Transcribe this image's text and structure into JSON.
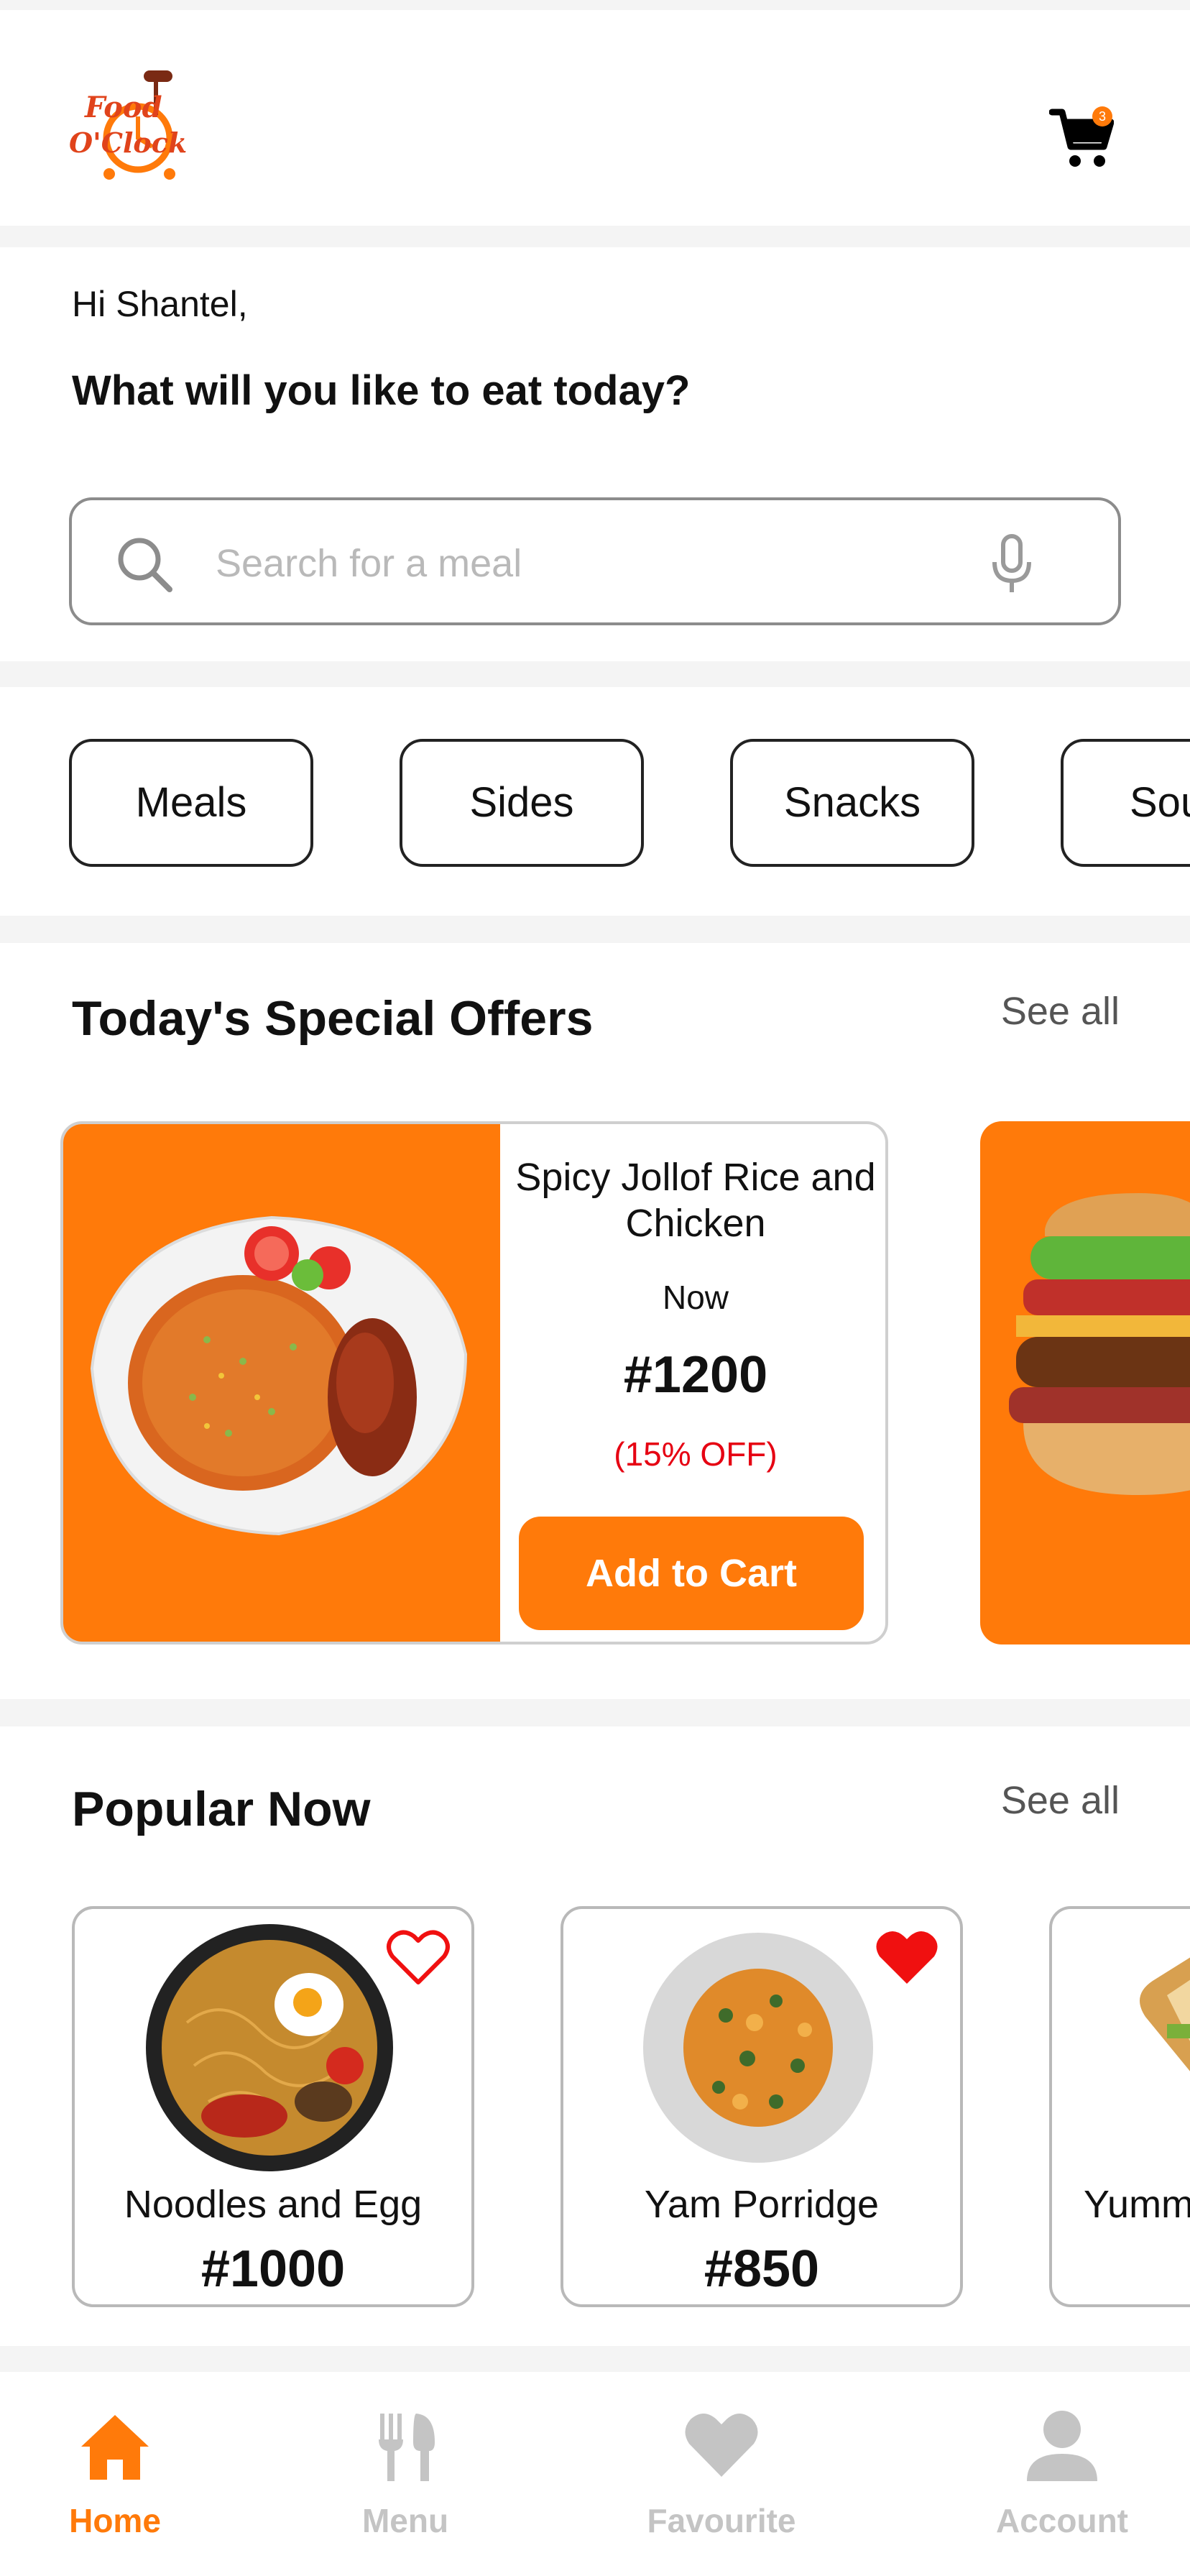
{
  "header": {
    "logo_line1": "Food",
    "logo_line2": "O'Clock",
    "cart_count": "3"
  },
  "greeting": {
    "hi": "Hi Shantel,",
    "question": "What will you like to eat today?"
  },
  "search": {
    "placeholder": "Search for a meal"
  },
  "categories": [
    "Meals",
    "Sides",
    "Snacks",
    "Sou"
  ],
  "specials": {
    "title": "Today's  Special Offers",
    "see_all": "See all",
    "offer": {
      "name": "Spicy Jollof Rice and Chicken",
      "now": "Now",
      "price": "#1200",
      "discount": "(15% OFF)",
      "button": "Add to Cart"
    }
  },
  "popular": {
    "title": "Popular Now",
    "see_all": "See all",
    "items": [
      {
        "name": "Noodles and Egg",
        "price": "#1000",
        "favourite": false
      },
      {
        "name": "Yam Porridge",
        "price": "#850",
        "favourite": true
      },
      {
        "name": "Yumm",
        "price": "",
        "favourite": false
      }
    ]
  },
  "nav": {
    "items": [
      {
        "label": "Home",
        "icon": "home-icon",
        "active": true
      },
      {
        "label": "Menu",
        "icon": "utensils-icon",
        "active": false
      },
      {
        "label": "Favourite",
        "icon": "heart-icon",
        "active": false
      },
      {
        "label": "Account",
        "icon": "user-icon",
        "active": false
      }
    ]
  },
  "colors": {
    "accent": "#ff7a0a",
    "discount": "#e60012",
    "favourite": "#f01010",
    "nav_inactive": "#c4c4c4"
  }
}
